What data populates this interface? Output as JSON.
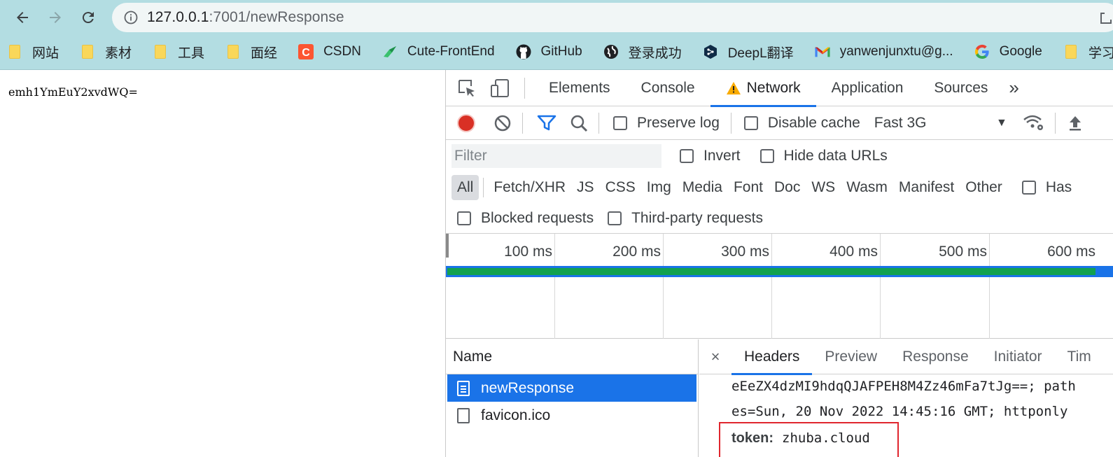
{
  "browser": {
    "url_host": "127.0.0.1",
    "url_path": ":7001/newResponse",
    "bookmarks": [
      {
        "label": "网站",
        "icon": "folder-icon"
      },
      {
        "label": "素材",
        "icon": "folder-icon"
      },
      {
        "label": "工具",
        "icon": "folder-icon"
      },
      {
        "label": "面经",
        "icon": "folder-icon"
      },
      {
        "label": "CSDN",
        "icon": "csdn-icon"
      },
      {
        "label": "Cute-FrontEnd",
        "icon": "bird-icon"
      },
      {
        "label": "GitHub",
        "icon": "github-icon"
      },
      {
        "label": "登录成功",
        "icon": "globe-icon"
      },
      {
        "label": "DeepL翻译",
        "icon": "deepl-icon"
      },
      {
        "label": "yanwenjunxtu@g...",
        "icon": "gmail-icon"
      },
      {
        "label": "Google",
        "icon": "google-icon"
      },
      {
        "label": "学习",
        "icon": "folder-icon"
      }
    ]
  },
  "page": {
    "body_text": "emh1YmEuY2xvdWQ="
  },
  "devtools": {
    "tabs": [
      {
        "label": "Elements"
      },
      {
        "label": "Console"
      },
      {
        "label": "Network"
      },
      {
        "label": "Application"
      },
      {
        "label": "Sources"
      }
    ],
    "more_tabs": "»",
    "toolbar": {
      "preserve_log": "Preserve log",
      "disable_cache": "Disable cache",
      "throttle": "Fast 3G"
    },
    "filter": {
      "placeholder": "Filter",
      "invert": "Invert",
      "hide_data_urls": "Hide data URLs"
    },
    "types": [
      "All",
      "Fetch/XHR",
      "JS",
      "CSS",
      "Img",
      "Media",
      "Font",
      "Doc",
      "WS",
      "Wasm",
      "Manifest",
      "Other"
    ],
    "has_label": "Has",
    "blocked_requests": "Blocked requests",
    "third_party_requests": "Third-party requests",
    "timeline_ticks": [
      "100 ms",
      "200 ms",
      "300 ms",
      "400 ms",
      "500 ms",
      "600 ms"
    ],
    "requests": {
      "name_header": "Name",
      "rows": [
        {
          "name": "newResponse",
          "selected": true
        },
        {
          "name": "favicon.ico",
          "selected": false
        }
      ]
    },
    "details": {
      "close": "×",
      "tabs": [
        "Headers",
        "Preview",
        "Response",
        "Initiator",
        "Tim"
      ],
      "line1": "eEeZX4dzMI9hdqQJAFPEH8M4Zz46mFa7tJg==; path",
      "line2": "es=Sun, 20 Nov 2022 14:45:16 GMT; httponly",
      "token_key": "token:",
      "token_value": "zhuba.cloud"
    },
    "colors": {
      "accent": "#1a73e8",
      "record": "#d93025",
      "highlight_box": "#e0262e",
      "waterfall_bar": "#12a150"
    }
  }
}
